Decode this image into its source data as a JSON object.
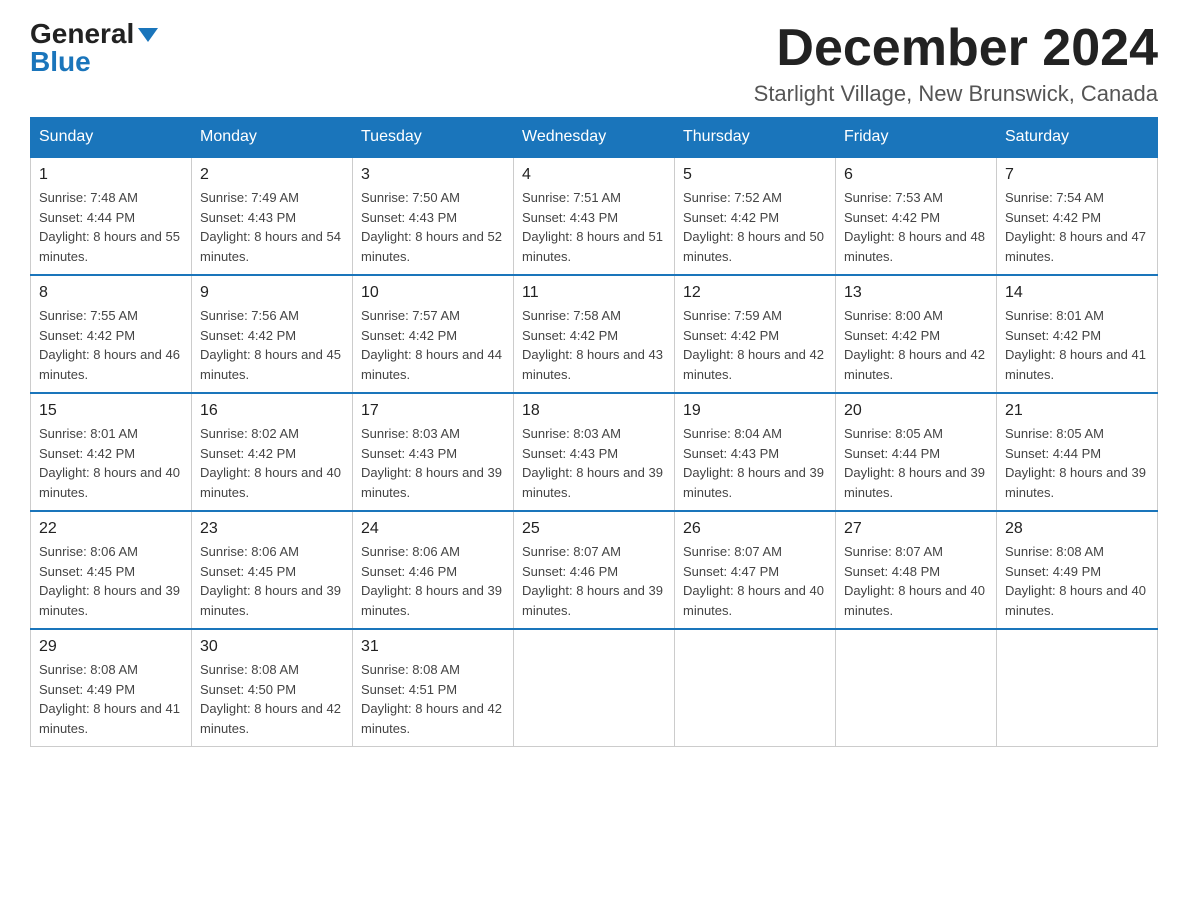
{
  "header": {
    "logo_general": "General",
    "logo_blue": "Blue",
    "month_title": "December 2024",
    "location": "Starlight Village, New Brunswick, Canada"
  },
  "days_of_week": [
    "Sunday",
    "Monday",
    "Tuesday",
    "Wednesday",
    "Thursday",
    "Friday",
    "Saturday"
  ],
  "weeks": [
    [
      {
        "day": "1",
        "sunrise": "7:48 AM",
        "sunset": "4:44 PM",
        "daylight": "8 hours and 55 minutes."
      },
      {
        "day": "2",
        "sunrise": "7:49 AM",
        "sunset": "4:43 PM",
        "daylight": "8 hours and 54 minutes."
      },
      {
        "day": "3",
        "sunrise": "7:50 AM",
        "sunset": "4:43 PM",
        "daylight": "8 hours and 52 minutes."
      },
      {
        "day": "4",
        "sunrise": "7:51 AM",
        "sunset": "4:43 PM",
        "daylight": "8 hours and 51 minutes."
      },
      {
        "day": "5",
        "sunrise": "7:52 AM",
        "sunset": "4:42 PM",
        "daylight": "8 hours and 50 minutes."
      },
      {
        "day": "6",
        "sunrise": "7:53 AM",
        "sunset": "4:42 PM",
        "daylight": "8 hours and 48 minutes."
      },
      {
        "day": "7",
        "sunrise": "7:54 AM",
        "sunset": "4:42 PM",
        "daylight": "8 hours and 47 minutes."
      }
    ],
    [
      {
        "day": "8",
        "sunrise": "7:55 AM",
        "sunset": "4:42 PM",
        "daylight": "8 hours and 46 minutes."
      },
      {
        "day": "9",
        "sunrise": "7:56 AM",
        "sunset": "4:42 PM",
        "daylight": "8 hours and 45 minutes."
      },
      {
        "day": "10",
        "sunrise": "7:57 AM",
        "sunset": "4:42 PM",
        "daylight": "8 hours and 44 minutes."
      },
      {
        "day": "11",
        "sunrise": "7:58 AM",
        "sunset": "4:42 PM",
        "daylight": "8 hours and 43 minutes."
      },
      {
        "day": "12",
        "sunrise": "7:59 AM",
        "sunset": "4:42 PM",
        "daylight": "8 hours and 42 minutes."
      },
      {
        "day": "13",
        "sunrise": "8:00 AM",
        "sunset": "4:42 PM",
        "daylight": "8 hours and 42 minutes."
      },
      {
        "day": "14",
        "sunrise": "8:01 AM",
        "sunset": "4:42 PM",
        "daylight": "8 hours and 41 minutes."
      }
    ],
    [
      {
        "day": "15",
        "sunrise": "8:01 AM",
        "sunset": "4:42 PM",
        "daylight": "8 hours and 40 minutes."
      },
      {
        "day": "16",
        "sunrise": "8:02 AM",
        "sunset": "4:42 PM",
        "daylight": "8 hours and 40 minutes."
      },
      {
        "day": "17",
        "sunrise": "8:03 AM",
        "sunset": "4:43 PM",
        "daylight": "8 hours and 39 minutes."
      },
      {
        "day": "18",
        "sunrise": "8:03 AM",
        "sunset": "4:43 PM",
        "daylight": "8 hours and 39 minutes."
      },
      {
        "day": "19",
        "sunrise": "8:04 AM",
        "sunset": "4:43 PM",
        "daylight": "8 hours and 39 minutes."
      },
      {
        "day": "20",
        "sunrise": "8:05 AM",
        "sunset": "4:44 PM",
        "daylight": "8 hours and 39 minutes."
      },
      {
        "day": "21",
        "sunrise": "8:05 AM",
        "sunset": "4:44 PM",
        "daylight": "8 hours and 39 minutes."
      }
    ],
    [
      {
        "day": "22",
        "sunrise": "8:06 AM",
        "sunset": "4:45 PM",
        "daylight": "8 hours and 39 minutes."
      },
      {
        "day": "23",
        "sunrise": "8:06 AM",
        "sunset": "4:45 PM",
        "daylight": "8 hours and 39 minutes."
      },
      {
        "day": "24",
        "sunrise": "8:06 AM",
        "sunset": "4:46 PM",
        "daylight": "8 hours and 39 minutes."
      },
      {
        "day": "25",
        "sunrise": "8:07 AM",
        "sunset": "4:46 PM",
        "daylight": "8 hours and 39 minutes."
      },
      {
        "day": "26",
        "sunrise": "8:07 AM",
        "sunset": "4:47 PM",
        "daylight": "8 hours and 40 minutes."
      },
      {
        "day": "27",
        "sunrise": "8:07 AM",
        "sunset": "4:48 PM",
        "daylight": "8 hours and 40 minutes."
      },
      {
        "day": "28",
        "sunrise": "8:08 AM",
        "sunset": "4:49 PM",
        "daylight": "8 hours and 40 minutes."
      }
    ],
    [
      {
        "day": "29",
        "sunrise": "8:08 AM",
        "sunset": "4:49 PM",
        "daylight": "8 hours and 41 minutes."
      },
      {
        "day": "30",
        "sunrise": "8:08 AM",
        "sunset": "4:50 PM",
        "daylight": "8 hours and 42 minutes."
      },
      {
        "day": "31",
        "sunrise": "8:08 AM",
        "sunset": "4:51 PM",
        "daylight": "8 hours and 42 minutes."
      },
      null,
      null,
      null,
      null
    ]
  ],
  "labels": {
    "sunrise": "Sunrise: ",
    "sunset": "Sunset: ",
    "daylight": "Daylight: "
  }
}
